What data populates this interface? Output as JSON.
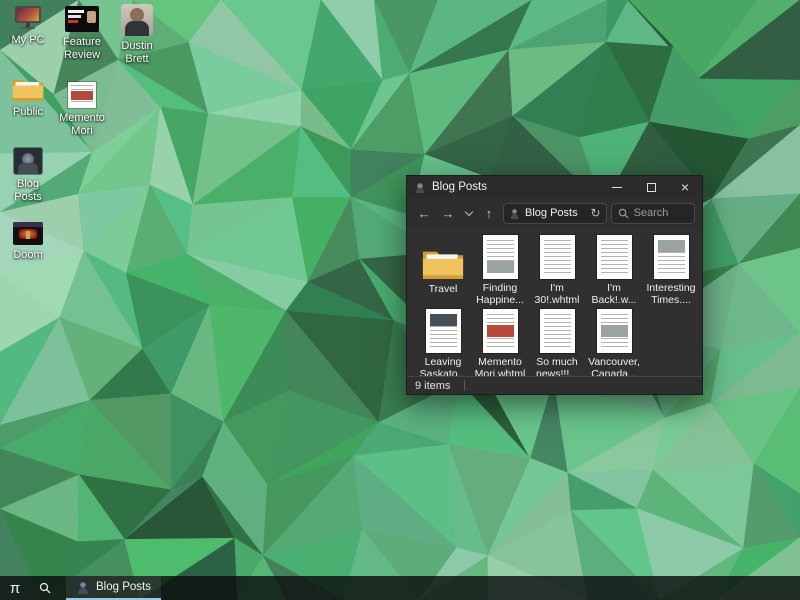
{
  "desktop": {
    "icons": [
      {
        "label": "My PC",
        "icon": "computer-icon"
      },
      {
        "label": "Feature Review",
        "icon": "video-thumbnail-icon"
      },
      {
        "label": "Dustin Brett",
        "icon": "person-photo-icon"
      },
      {
        "label": "Public",
        "icon": "folder-icon"
      },
      {
        "label": "Memento Mori",
        "icon": "image-thumbnail-icon"
      },
      {
        "label": "Blog Posts",
        "icon": "dark-photo-icon"
      },
      {
        "label": "Doom",
        "icon": "game-thumbnail-icon"
      }
    ]
  },
  "window": {
    "title": "Blog Posts",
    "controls": {
      "minimize_icon": "minimize",
      "maximize_icon": "maximize",
      "close_icon": "×"
    },
    "nav": {
      "back_icon": "←",
      "forward_icon": "→",
      "recent_icon": "chevron-down",
      "up_icon": "↑",
      "refresh_icon": "↻",
      "address_value": "Blog Posts",
      "search_placeholder": "Search"
    },
    "files": [
      {
        "name": "Travel",
        "icon": "folder-icon"
      },
      {
        "name": "Finding Happine...",
        "icon": "document-thumbnail-icon"
      },
      {
        "name": "I'm 30!.whtml",
        "icon": "document-thumbnail-icon"
      },
      {
        "name": "I'm Back!.w...",
        "icon": "document-thumbnail-icon"
      },
      {
        "name": "Interesting Times....",
        "icon": "document-thumbnail-icon"
      },
      {
        "name": "Leaving Saskato...",
        "icon": "document-thumbnail-icon"
      },
      {
        "name": "Memento Mori.whtml",
        "icon": "document-thumbnail-icon"
      },
      {
        "name": "So much news!!!...",
        "icon": "document-thumbnail-icon"
      },
      {
        "name": "Vancouver, Canada...",
        "icon": "document-thumbnail-icon"
      }
    ],
    "status": {
      "items_count": "9 items"
    }
  },
  "taskbar": {
    "start_icon": "π",
    "search_icon": "magnifier",
    "active_app": {
      "label": "Blog Posts"
    }
  },
  "colors": {
    "wallpaper_base": "#4e9a6f",
    "accent_underline": "#9ac9e8",
    "window_background": "#303030"
  }
}
